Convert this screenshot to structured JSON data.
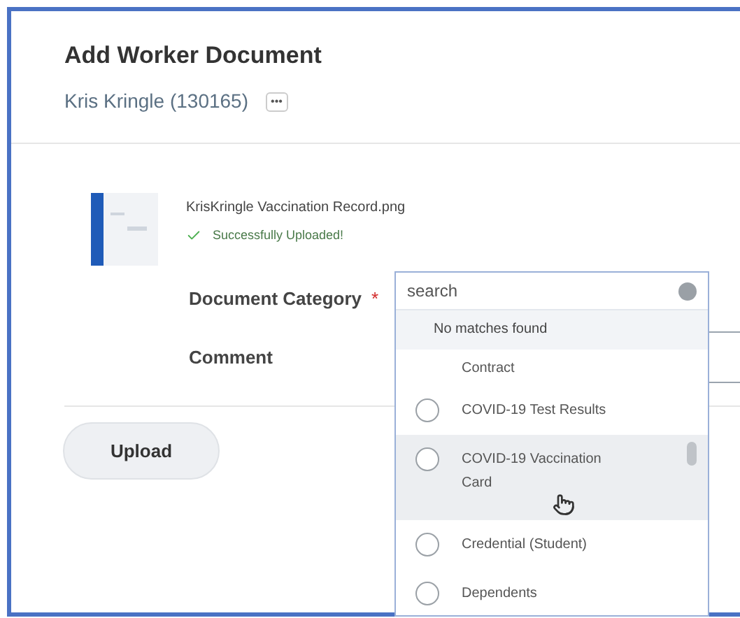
{
  "title": "Add Worker Document",
  "worker": {
    "name": "Kris Kringle (130165)",
    "menu": "•••"
  },
  "file": {
    "name": "KrisKringle Vaccination Record.png",
    "status": "Successfully Uploaded!",
    "uploaded": true
  },
  "fields": [
    {
      "label": "Document Category",
      "required_mark": "*"
    },
    {
      "label": "Comment"
    }
  ],
  "dropdown": {
    "search": {
      "placeholder": "search"
    },
    "message": "No matches found",
    "options": [
      {
        "label": "Contract",
        "kind": "cut"
      },
      {
        "label": "COVID-19 Test Results",
        "kind": "radio",
        "selected": false,
        "highlighted": false
      },
      {
        "label": "COVID-19 Vaccination Card",
        "kind": "radio",
        "selected": false,
        "highlighted": true
      },
      {
        "label": "Credential (Student)",
        "kind": "radio",
        "selected": false,
        "highlighted": false
      },
      {
        "label": "Dependents",
        "kind": "radio",
        "selected": false,
        "highlighted": false
      }
    ]
  },
  "buttons": [
    {
      "label": "Upload"
    }
  ]
}
